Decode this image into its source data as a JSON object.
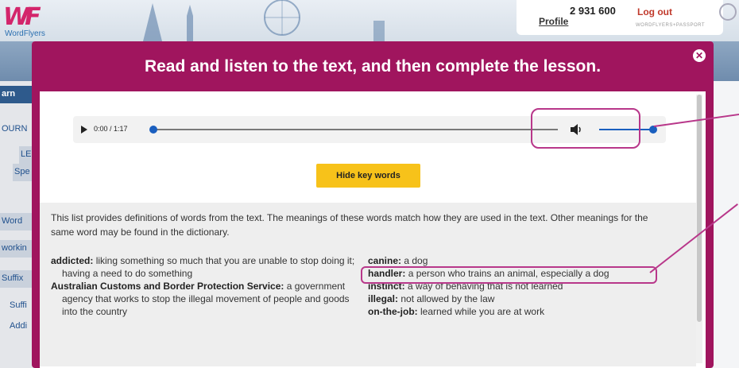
{
  "site": {
    "logo_text": "WordFlyers",
    "profile_label": "Profile",
    "points": "2 931 600",
    "logout_label": "Log out",
    "passport_text": "WORDFLYERS+PASSPORT"
  },
  "background_nav": {
    "items": [
      "arn",
      "OURN",
      "LESS",
      "Spe",
      "Word",
      "workin",
      "Suffix",
      "Suffi",
      "Addi"
    ]
  },
  "modal": {
    "title": "Read and listen to the text, and then complete the lesson.",
    "close_label": "✕"
  },
  "audio": {
    "time": "0:00 / 1:17",
    "progress": 0,
    "volume": 1
  },
  "buttons": {
    "hide_key_words": "Hide key words"
  },
  "key_words": {
    "intro": "This list provides definitions of words from the text. The meanings of these words match how they are used in the text. Other meanings for the same word may be found in the dictionary.",
    "left": [
      {
        "term": "addicted:",
        "definition": "liking something so much that you are unable to stop doing it; having a need to do something"
      },
      {
        "term": "Australian Customs and Border Protection Service:",
        "definition": "a government agency that works to stop the illegal movement of people and goods into the country"
      }
    ],
    "right": [
      {
        "term": "canine:",
        "definition": "a dog"
      },
      {
        "term": "handler:",
        "definition": "a person who trains an animal, especially a dog"
      },
      {
        "term": "instinct:",
        "definition": "a way of behaving that is not learned"
      },
      {
        "term": "illegal:",
        "definition": "not allowed by the law"
      },
      {
        "term": "on-the-job:",
        "definition": "learned while you are at work"
      }
    ]
  },
  "colors": {
    "modal_accent": "#a0155e",
    "callout": "#b8378a",
    "button": "#f7c21a",
    "audio_accent": "#1a5fbf"
  }
}
